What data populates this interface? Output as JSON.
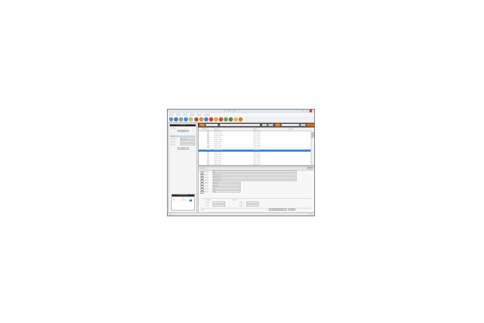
{
  "window": {
    "title": "○○ · ○○○ · ○○○"
  },
  "menu": [
    "○○○",
    "○○○",
    "○○○",
    "○○○",
    "○○○",
    "○○○○"
  ],
  "toolbar_icons": [
    "open-icon",
    "save-icon",
    "print-icon",
    "globe-icon",
    "book-icon",
    "tool-icon",
    "orange-ball-icon",
    "people-icon",
    "red-ball-icon",
    "chart-icon",
    "pencil-icon",
    "flag-icon",
    "tag-icon",
    "star-icon",
    "help-icon"
  ],
  "left": {
    "header": "○○ ○○",
    "label1": "○○ ○○",
    "button1": "○○ ○○",
    "section": "○○○",
    "labels": [
      "○○○○",
      "○○○○",
      "○○○○"
    ],
    "field_value": "○○ ○○",
    "search_button": "○○",
    "mini_header": "○○ ○○ ○○",
    "mini_rows": [
      {
        "a": "○○",
        "b": "○○○"
      },
      {
        "a": "○○",
        "b": "○○○○"
      }
    ]
  },
  "search": {
    "label1": "○○",
    "label2": "○○",
    "btn1": "○○",
    "btn2": "○○",
    "btn3": "○○"
  },
  "grid": {
    "headers": [
      "○○○○",
      "○○○○",
      "○○○",
      "○○○○"
    ],
    "rows": [
      [
        "101",
        "○○○○○ ○○",
        "○○○ ○○○"
      ],
      [
        "102",
        "○○○○ ○○○",
        "○○○ ○○○"
      ],
      [
        "103",
        "○○○○ ○○○○",
        "○○○ ○○○"
      ],
      [
        "104",
        "○○○○ ○○",
        "○○○ ○○○"
      ],
      [
        "105",
        "○○○○ ○○○",
        "○○○ ○○○"
      ],
      [
        "106",
        "○○○○ ○○○",
        "○○○ ○○○"
      ],
      [
        "107",
        "○○○○ ○○",
        "○○○ ○○○"
      ],
      [
        "108",
        "○○○○ ○○○",
        "○○○ ○○○"
      ],
      [
        "109",
        "○○○○ ○○",
        "○○○ ○○○"
      ],
      [
        "110",
        "○○○○ ○○○",
        "○○○ ○○○"
      ],
      [
        "111",
        "○○○○ ○○",
        "○○○ ○○○"
      ],
      [
        "112",
        "○○○○ ○○○",
        "○○○ ○○○"
      ],
      [
        "113",
        "○○○○ ○○",
        "○○○ ○○○"
      ],
      [
        "114",
        "○○○○ ○○○",
        "○○○ ○○○"
      ],
      [
        "115",
        "○○○○ ○○",
        "○○○ ○○○"
      ],
      [
        "116",
        "○○○○ ○○○",
        "○○○ ○○○"
      ],
      [
        "117",
        "○○○○ ○○",
        "○○○ ○○○"
      ]
    ],
    "selected_index": 9
  },
  "detail": {
    "header": "○○ ○○",
    "corner_button": "○○",
    "labels": [
      "○○○○",
      "○○○○",
      "○○○○",
      "○○○○",
      "○○○○",
      "○○○○",
      "○○○○",
      "○○○○"
    ],
    "values": [
      "○○",
      "○○○○ ○○",
      "○○○○ ○○",
      "○○○○ ○○",
      "○○○○",
      "○○○○",
      "○○",
      "○○"
    ],
    "extra": [
      "○○○○",
      "○○○○",
      "○○○",
      "○○○"
    ],
    "bottom_left": "○○○",
    "bottom_right": "○○○○ ○○○○",
    "bottom_button": "○○"
  },
  "status": {
    "left": "○○",
    "right": "○○"
  }
}
